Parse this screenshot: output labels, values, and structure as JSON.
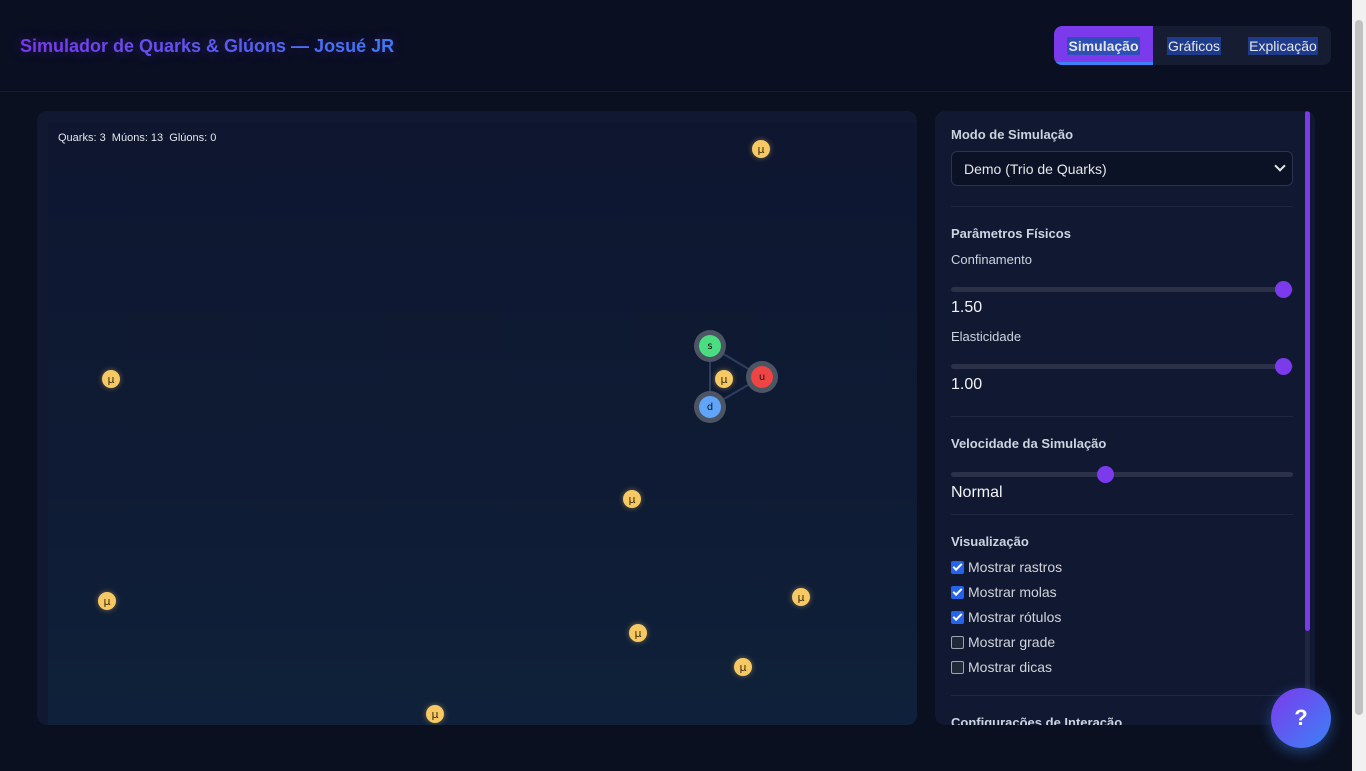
{
  "header": {
    "title": "Simulador de Quarks & Glúons — Josué JR",
    "tabs": [
      {
        "label": "Simulação",
        "active": true
      },
      {
        "label": "Gráficos",
        "active": false
      },
      {
        "label": "Explicação",
        "active": false
      }
    ]
  },
  "simulation": {
    "counters": "Quarks: 3  Múons: 13  Glúons: 0",
    "muon_symbol": "μ",
    "quarks": [
      {
        "label": "s",
        "color": "#4ade80"
      },
      {
        "label": "u",
        "color": "#ef4444"
      },
      {
        "label": "d",
        "color": "#60a5fa"
      }
    ]
  },
  "controls": {
    "mode": {
      "title": "Modo de Simulação",
      "selected": "Demo (Trio de Quarks)"
    },
    "physics": {
      "title": "Parâmetros Físicos",
      "confinement_label": "Confinamento",
      "confinement_value": "1.50",
      "confinement_fraction": 0.97,
      "elasticity_label": "Elasticidade",
      "elasticity_value": "1.00",
      "elasticity_fraction": 0.97
    },
    "speed": {
      "title": "Velocidade da Simulação",
      "value": "Normal",
      "fraction": 0.45
    },
    "visualization": {
      "title": "Visualização",
      "options": [
        {
          "label": "Mostrar rastros",
          "checked": true
        },
        {
          "label": "Mostrar molas",
          "checked": true
        },
        {
          "label": "Mostrar rótulos",
          "checked": true
        },
        {
          "label": "Mostrar grade",
          "checked": false
        },
        {
          "label": "Mostrar dicas",
          "checked": false
        }
      ]
    },
    "interaction": {
      "title": "Configurações de Interação"
    }
  },
  "help_button": "?",
  "colors": {
    "accent": "#7c3aed",
    "accent2": "#3b82f6",
    "muon": "#f6c965"
  }
}
